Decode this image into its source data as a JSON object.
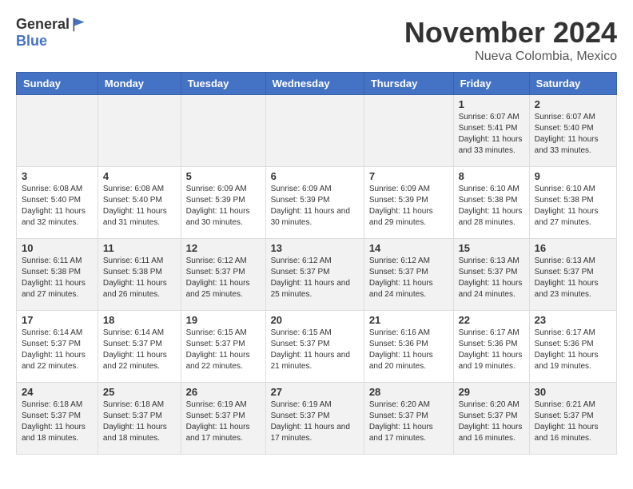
{
  "logo": {
    "general": "General",
    "blue": "Blue"
  },
  "title": "November 2024",
  "subtitle": "Nueva Colombia, Mexico",
  "days_of_week": [
    "Sunday",
    "Monday",
    "Tuesday",
    "Wednesday",
    "Thursday",
    "Friday",
    "Saturday"
  ],
  "weeks": [
    [
      {
        "day": "",
        "info": ""
      },
      {
        "day": "",
        "info": ""
      },
      {
        "day": "",
        "info": ""
      },
      {
        "day": "",
        "info": ""
      },
      {
        "day": "",
        "info": ""
      },
      {
        "day": "1",
        "info": "Sunrise: 6:07 AM\nSunset: 5:41 PM\nDaylight: 11 hours and 33 minutes."
      },
      {
        "day": "2",
        "info": "Sunrise: 6:07 AM\nSunset: 5:40 PM\nDaylight: 11 hours and 33 minutes."
      }
    ],
    [
      {
        "day": "3",
        "info": "Sunrise: 6:08 AM\nSunset: 5:40 PM\nDaylight: 11 hours and 32 minutes."
      },
      {
        "day": "4",
        "info": "Sunrise: 6:08 AM\nSunset: 5:40 PM\nDaylight: 11 hours and 31 minutes."
      },
      {
        "day": "5",
        "info": "Sunrise: 6:09 AM\nSunset: 5:39 PM\nDaylight: 11 hours and 30 minutes."
      },
      {
        "day": "6",
        "info": "Sunrise: 6:09 AM\nSunset: 5:39 PM\nDaylight: 11 hours and 30 minutes."
      },
      {
        "day": "7",
        "info": "Sunrise: 6:09 AM\nSunset: 5:39 PM\nDaylight: 11 hours and 29 minutes."
      },
      {
        "day": "8",
        "info": "Sunrise: 6:10 AM\nSunset: 5:38 PM\nDaylight: 11 hours and 28 minutes."
      },
      {
        "day": "9",
        "info": "Sunrise: 6:10 AM\nSunset: 5:38 PM\nDaylight: 11 hours and 27 minutes."
      }
    ],
    [
      {
        "day": "10",
        "info": "Sunrise: 6:11 AM\nSunset: 5:38 PM\nDaylight: 11 hours and 27 minutes."
      },
      {
        "day": "11",
        "info": "Sunrise: 6:11 AM\nSunset: 5:38 PM\nDaylight: 11 hours and 26 minutes."
      },
      {
        "day": "12",
        "info": "Sunrise: 6:12 AM\nSunset: 5:37 PM\nDaylight: 11 hours and 25 minutes."
      },
      {
        "day": "13",
        "info": "Sunrise: 6:12 AM\nSunset: 5:37 PM\nDaylight: 11 hours and 25 minutes."
      },
      {
        "day": "14",
        "info": "Sunrise: 6:12 AM\nSunset: 5:37 PM\nDaylight: 11 hours and 24 minutes."
      },
      {
        "day": "15",
        "info": "Sunrise: 6:13 AM\nSunset: 5:37 PM\nDaylight: 11 hours and 24 minutes."
      },
      {
        "day": "16",
        "info": "Sunrise: 6:13 AM\nSunset: 5:37 PM\nDaylight: 11 hours and 23 minutes."
      }
    ],
    [
      {
        "day": "17",
        "info": "Sunrise: 6:14 AM\nSunset: 5:37 PM\nDaylight: 11 hours and 22 minutes."
      },
      {
        "day": "18",
        "info": "Sunrise: 6:14 AM\nSunset: 5:37 PM\nDaylight: 11 hours and 22 minutes."
      },
      {
        "day": "19",
        "info": "Sunrise: 6:15 AM\nSunset: 5:37 PM\nDaylight: 11 hours and 22 minutes."
      },
      {
        "day": "20",
        "info": "Sunrise: 6:15 AM\nSunset: 5:37 PM\nDaylight: 11 hours and 21 minutes."
      },
      {
        "day": "21",
        "info": "Sunrise: 6:16 AM\nSunset: 5:36 PM\nDaylight: 11 hours and 20 minutes."
      },
      {
        "day": "22",
        "info": "Sunrise: 6:17 AM\nSunset: 5:36 PM\nDaylight: 11 hours and 19 minutes."
      },
      {
        "day": "23",
        "info": "Sunrise: 6:17 AM\nSunset: 5:36 PM\nDaylight: 11 hours and 19 minutes."
      }
    ],
    [
      {
        "day": "24",
        "info": "Sunrise: 6:18 AM\nSunset: 5:37 PM\nDaylight: 11 hours and 18 minutes."
      },
      {
        "day": "25",
        "info": "Sunrise: 6:18 AM\nSunset: 5:37 PM\nDaylight: 11 hours and 18 minutes."
      },
      {
        "day": "26",
        "info": "Sunrise: 6:19 AM\nSunset: 5:37 PM\nDaylight: 11 hours and 17 minutes."
      },
      {
        "day": "27",
        "info": "Sunrise: 6:19 AM\nSunset: 5:37 PM\nDaylight: 11 hours and 17 minutes."
      },
      {
        "day": "28",
        "info": "Sunrise: 6:20 AM\nSunset: 5:37 PM\nDaylight: 11 hours and 17 minutes."
      },
      {
        "day": "29",
        "info": "Sunrise: 6:20 AM\nSunset: 5:37 PM\nDaylight: 11 hours and 16 minutes."
      },
      {
        "day": "30",
        "info": "Sunrise: 6:21 AM\nSunset: 5:37 PM\nDaylight: 11 hours and 16 minutes."
      }
    ]
  ]
}
